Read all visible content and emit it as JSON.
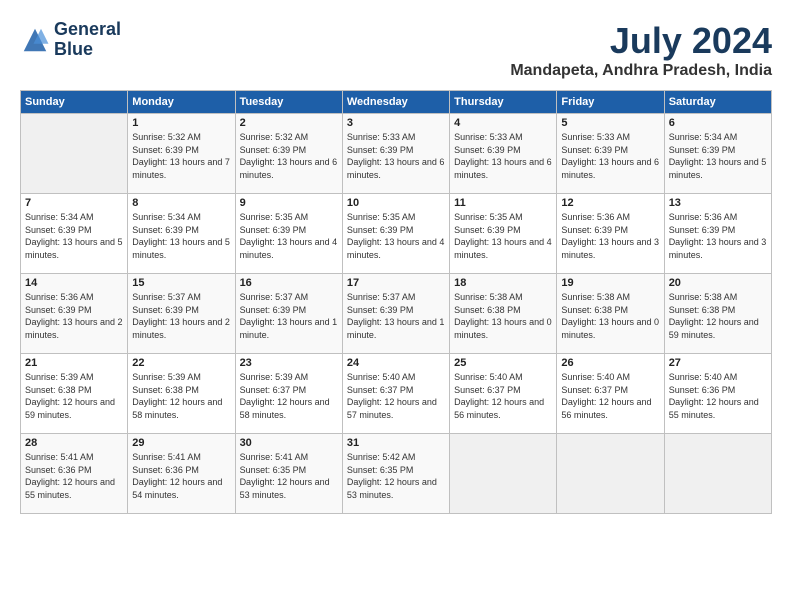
{
  "logo": {
    "line1": "General",
    "line2": "Blue"
  },
  "title": "July 2024",
  "location": "Mandapeta, Andhra Pradesh, India",
  "days_of_week": [
    "Sunday",
    "Monday",
    "Tuesday",
    "Wednesday",
    "Thursday",
    "Friday",
    "Saturday"
  ],
  "weeks": [
    [
      {
        "day": "",
        "sunrise": "",
        "sunset": "",
        "daylight": ""
      },
      {
        "day": "1",
        "sunrise": "Sunrise: 5:32 AM",
        "sunset": "Sunset: 6:39 PM",
        "daylight": "Daylight: 13 hours and 7 minutes."
      },
      {
        "day": "2",
        "sunrise": "Sunrise: 5:32 AM",
        "sunset": "Sunset: 6:39 PM",
        "daylight": "Daylight: 13 hours and 6 minutes."
      },
      {
        "day": "3",
        "sunrise": "Sunrise: 5:33 AM",
        "sunset": "Sunset: 6:39 PM",
        "daylight": "Daylight: 13 hours and 6 minutes."
      },
      {
        "day": "4",
        "sunrise": "Sunrise: 5:33 AM",
        "sunset": "Sunset: 6:39 PM",
        "daylight": "Daylight: 13 hours and 6 minutes."
      },
      {
        "day": "5",
        "sunrise": "Sunrise: 5:33 AM",
        "sunset": "Sunset: 6:39 PM",
        "daylight": "Daylight: 13 hours and 6 minutes."
      },
      {
        "day": "6",
        "sunrise": "Sunrise: 5:34 AM",
        "sunset": "Sunset: 6:39 PM",
        "daylight": "Daylight: 13 hours and 5 minutes."
      }
    ],
    [
      {
        "day": "7",
        "sunrise": "Sunrise: 5:34 AM",
        "sunset": "Sunset: 6:39 PM",
        "daylight": "Daylight: 13 hours and 5 minutes."
      },
      {
        "day": "8",
        "sunrise": "Sunrise: 5:34 AM",
        "sunset": "Sunset: 6:39 PM",
        "daylight": "Daylight: 13 hours and 5 minutes."
      },
      {
        "day": "9",
        "sunrise": "Sunrise: 5:35 AM",
        "sunset": "Sunset: 6:39 PM",
        "daylight": "Daylight: 13 hours and 4 minutes."
      },
      {
        "day": "10",
        "sunrise": "Sunrise: 5:35 AM",
        "sunset": "Sunset: 6:39 PM",
        "daylight": "Daylight: 13 hours and 4 minutes."
      },
      {
        "day": "11",
        "sunrise": "Sunrise: 5:35 AM",
        "sunset": "Sunset: 6:39 PM",
        "daylight": "Daylight: 13 hours and 4 minutes."
      },
      {
        "day": "12",
        "sunrise": "Sunrise: 5:36 AM",
        "sunset": "Sunset: 6:39 PM",
        "daylight": "Daylight: 13 hours and 3 minutes."
      },
      {
        "day": "13",
        "sunrise": "Sunrise: 5:36 AM",
        "sunset": "Sunset: 6:39 PM",
        "daylight": "Daylight: 13 hours and 3 minutes."
      }
    ],
    [
      {
        "day": "14",
        "sunrise": "Sunrise: 5:36 AM",
        "sunset": "Sunset: 6:39 PM",
        "daylight": "Daylight: 13 hours and 2 minutes."
      },
      {
        "day": "15",
        "sunrise": "Sunrise: 5:37 AM",
        "sunset": "Sunset: 6:39 PM",
        "daylight": "Daylight: 13 hours and 2 minutes."
      },
      {
        "day": "16",
        "sunrise": "Sunrise: 5:37 AM",
        "sunset": "Sunset: 6:39 PM",
        "daylight": "Daylight: 13 hours and 1 minute."
      },
      {
        "day": "17",
        "sunrise": "Sunrise: 5:37 AM",
        "sunset": "Sunset: 6:39 PM",
        "daylight": "Daylight: 13 hours and 1 minute."
      },
      {
        "day": "18",
        "sunrise": "Sunrise: 5:38 AM",
        "sunset": "Sunset: 6:38 PM",
        "daylight": "Daylight: 13 hours and 0 minutes."
      },
      {
        "day": "19",
        "sunrise": "Sunrise: 5:38 AM",
        "sunset": "Sunset: 6:38 PM",
        "daylight": "Daylight: 13 hours and 0 minutes."
      },
      {
        "day": "20",
        "sunrise": "Sunrise: 5:38 AM",
        "sunset": "Sunset: 6:38 PM",
        "daylight": "Daylight: 12 hours and 59 minutes."
      }
    ],
    [
      {
        "day": "21",
        "sunrise": "Sunrise: 5:39 AM",
        "sunset": "Sunset: 6:38 PM",
        "daylight": "Daylight: 12 hours and 59 minutes."
      },
      {
        "day": "22",
        "sunrise": "Sunrise: 5:39 AM",
        "sunset": "Sunset: 6:38 PM",
        "daylight": "Daylight: 12 hours and 58 minutes."
      },
      {
        "day": "23",
        "sunrise": "Sunrise: 5:39 AM",
        "sunset": "Sunset: 6:37 PM",
        "daylight": "Daylight: 12 hours and 58 minutes."
      },
      {
        "day": "24",
        "sunrise": "Sunrise: 5:40 AM",
        "sunset": "Sunset: 6:37 PM",
        "daylight": "Daylight: 12 hours and 57 minutes."
      },
      {
        "day": "25",
        "sunrise": "Sunrise: 5:40 AM",
        "sunset": "Sunset: 6:37 PM",
        "daylight": "Daylight: 12 hours and 56 minutes."
      },
      {
        "day": "26",
        "sunrise": "Sunrise: 5:40 AM",
        "sunset": "Sunset: 6:37 PM",
        "daylight": "Daylight: 12 hours and 56 minutes."
      },
      {
        "day": "27",
        "sunrise": "Sunrise: 5:40 AM",
        "sunset": "Sunset: 6:36 PM",
        "daylight": "Daylight: 12 hours and 55 minutes."
      }
    ],
    [
      {
        "day": "28",
        "sunrise": "Sunrise: 5:41 AM",
        "sunset": "Sunset: 6:36 PM",
        "daylight": "Daylight: 12 hours and 55 minutes."
      },
      {
        "day": "29",
        "sunrise": "Sunrise: 5:41 AM",
        "sunset": "Sunset: 6:36 PM",
        "daylight": "Daylight: 12 hours and 54 minutes."
      },
      {
        "day": "30",
        "sunrise": "Sunrise: 5:41 AM",
        "sunset": "Sunset: 6:35 PM",
        "daylight": "Daylight: 12 hours and 53 minutes."
      },
      {
        "day": "31",
        "sunrise": "Sunrise: 5:42 AM",
        "sunset": "Sunset: 6:35 PM",
        "daylight": "Daylight: 12 hours and 53 minutes."
      },
      {
        "day": "",
        "sunrise": "",
        "sunset": "",
        "daylight": ""
      },
      {
        "day": "",
        "sunrise": "",
        "sunset": "",
        "daylight": ""
      },
      {
        "day": "",
        "sunrise": "",
        "sunset": "",
        "daylight": ""
      }
    ]
  ]
}
